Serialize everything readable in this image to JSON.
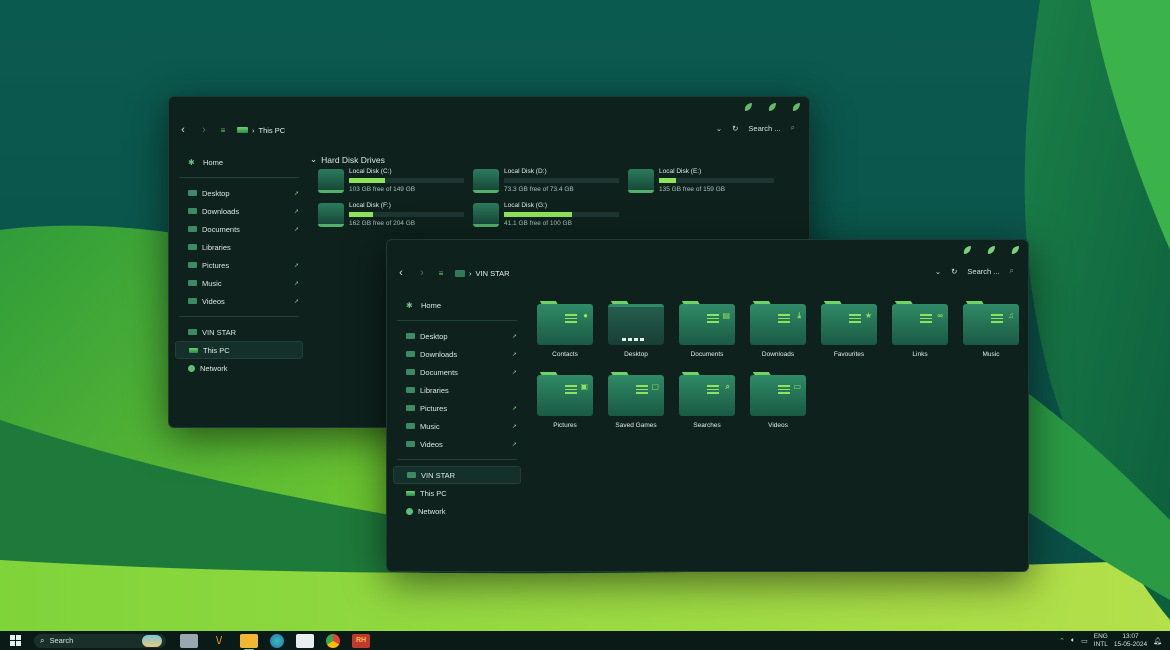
{
  "colors": {
    "accent": "#8fe35a",
    "window_bg": "#0e211d",
    "folder": "#2f8a66",
    "wallpaper_top": "#0a5a4e",
    "wallpaper_green": "#6cc63a"
  },
  "window_back": {
    "breadcrumb": "This PC",
    "search_placeholder": "Search ...",
    "section_title": "Hard Disk Drives",
    "sidebar": [
      {
        "label": "Home",
        "icon": "home-icon",
        "pinned": false
      },
      {
        "label": "Desktop",
        "icon": "folder-icon",
        "pinned": true
      },
      {
        "label": "Downloads",
        "icon": "folder-icon",
        "pinned": true
      },
      {
        "label": "Documents",
        "icon": "folder-icon",
        "pinned": true
      },
      {
        "label": "Libraries",
        "icon": "folder-icon",
        "pinned": false
      },
      {
        "label": "Pictures",
        "icon": "folder-icon",
        "pinned": true
      },
      {
        "label": "Music",
        "icon": "folder-icon",
        "pinned": true
      },
      {
        "label": "Videos",
        "icon": "folder-icon",
        "pinned": true
      },
      {
        "label": "VIN STAR",
        "icon": "folder-icon",
        "pinned": false
      },
      {
        "label": "This PC",
        "icon": "pc-icon",
        "pinned": false,
        "active": true
      },
      {
        "label": "Network",
        "icon": "network-icon",
        "pinned": false
      }
    ],
    "drives": [
      {
        "name": "Local Disk (C:)",
        "free": "103 GB free of 149 GB",
        "used_fraction": 0.31
      },
      {
        "name": "Local Disk (D:)",
        "free": "73.3 GB free of 73.4 GB",
        "used_fraction": 0.0
      },
      {
        "name": "Local Disk (E:)",
        "free": "135 GB free of 159 GB",
        "used_fraction": 0.15
      },
      {
        "name": "Local Disk (F:)",
        "free": "162 GB free of 204 GB",
        "used_fraction": 0.21
      },
      {
        "name": "Local Disk (G:)",
        "free": "41.1 GB free of 100 GB",
        "used_fraction": 0.59
      }
    ]
  },
  "window_front": {
    "breadcrumb": "VIN STAR",
    "search_placeholder": "Search ...",
    "sidebar": [
      {
        "label": "Home",
        "icon": "home-icon",
        "pinned": false
      },
      {
        "label": "Desktop",
        "icon": "folder-icon",
        "pinned": true
      },
      {
        "label": "Downloads",
        "icon": "folder-icon",
        "pinned": true
      },
      {
        "label": "Documents",
        "icon": "folder-icon",
        "pinned": true
      },
      {
        "label": "Libraries",
        "icon": "folder-icon",
        "pinned": false
      },
      {
        "label": "Pictures",
        "icon": "folder-icon",
        "pinned": true
      },
      {
        "label": "Music",
        "icon": "folder-icon",
        "pinned": true
      },
      {
        "label": "Videos",
        "icon": "folder-icon",
        "pinned": true
      },
      {
        "label": "VIN STAR",
        "icon": "folder-icon",
        "pinned": false,
        "active": true
      },
      {
        "label": "This PC",
        "icon": "pc-icon",
        "pinned": false
      },
      {
        "label": "Network",
        "icon": "network-icon",
        "pinned": false
      }
    ],
    "folders": [
      {
        "label": "Contacts",
        "glyph": "person-icon"
      },
      {
        "label": "Desktop",
        "glyph": "desktop-icon"
      },
      {
        "label": "Documents",
        "glyph": "document-icon"
      },
      {
        "label": "Downloads",
        "glyph": "download-icon"
      },
      {
        "label": "Favourites",
        "glyph": "star-icon"
      },
      {
        "label": "Links",
        "glyph": "link-icon"
      },
      {
        "label": "Music",
        "glyph": "music-icon"
      },
      {
        "label": "Pictures",
        "glyph": "picture-icon"
      },
      {
        "label": "Saved Games",
        "glyph": "game-icon"
      },
      {
        "label": "Searches",
        "glyph": "search-icon"
      },
      {
        "label": "Videos",
        "glyph": "video-icon"
      }
    ]
  },
  "taskbar": {
    "search_label": "Search",
    "apps": [
      "file-manager-icon",
      "brush-icon",
      "file-explorer-icon",
      "edge-icon",
      "store-icon",
      "chrome-icon",
      "rh-app-icon"
    ],
    "rh_label": "RH",
    "lang_top": "ENG",
    "lang_bottom": "INTL",
    "time": "13:07",
    "date": "15-05-2024"
  }
}
